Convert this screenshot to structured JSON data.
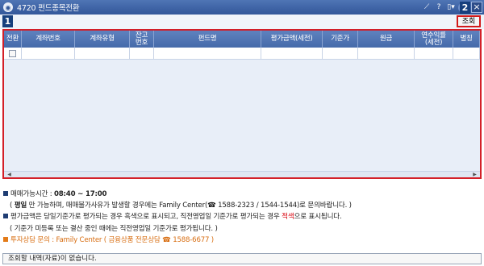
{
  "window": {
    "title": "4720 펀드종목전환",
    "tool_pin": "⟋",
    "tool_help": "?",
    "tool_menu": "▯▾",
    "tool_circle": "−",
    "tool_close": "×"
  },
  "badges": {
    "b1": "1",
    "b2": "2"
  },
  "toolbar": {
    "query_label": "조회"
  },
  "grid": {
    "columns": [
      "전환",
      "계좌번호",
      "계좌유형",
      "잔고\n번호",
      "펀드명",
      "평가금액(세전)",
      "기준가",
      "원금",
      "연수익률\n(세전)",
      "별칭"
    ]
  },
  "info": {
    "line1_label": "매매가능시간 : ",
    "line1_value": "08:40 ~ 17:00",
    "line2_prefix": "( ",
    "line2_bold": "평일",
    "line2_text": " 만 가능하며, 매매불가사유가 발생할 경우에는 Family Center(☎ 1588-2323 / 1544-1544)로 문의바랍니다. )",
    "line3_text": "평가금액은 당일기준가로 평가되는 경우 흑색으로 표시되고, 직전영업일 기준가로 평가되는 경우 ",
    "line3_red": "적색",
    "line3_end": "으로 표시됩니다.",
    "line4_text": "( 기준가 미등록 또는 결산 중인 때에는 직전영업일 기준가로 평가됩니다. )",
    "line5_text": "투자상담 문의 : Family Center ( 금융상품 전문상담 ☎ 1588-6677 )"
  },
  "status": {
    "message": "조회할 내역(자료)이 없습니다."
  }
}
